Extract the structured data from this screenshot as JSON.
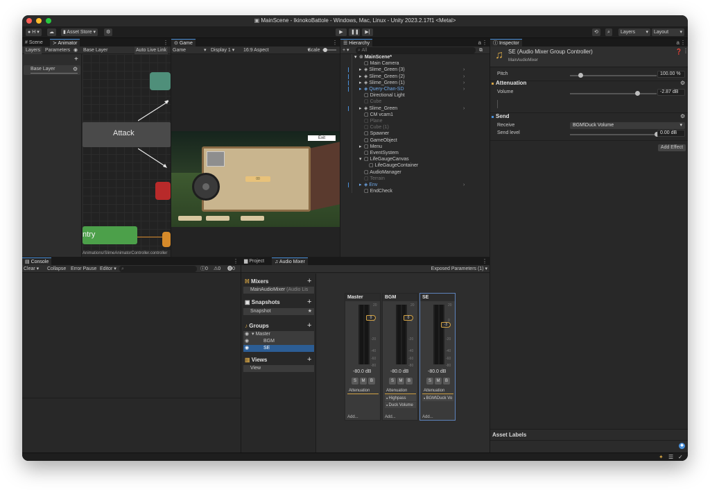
{
  "window": {
    "title": "MainScene - IkinokoBattole - Windows, Mac, Linux - Unity 2023.2.17f1 <Metal>"
  },
  "toolbar": {
    "account_label": "H",
    "asset_store_label": "Asset Store",
    "layers_label": "Layers",
    "layout_label": "Layout"
  },
  "scene_tab": {
    "label": "Scene"
  },
  "animator": {
    "tab_label": "Animator",
    "layers_tab": "Layers",
    "parameters_tab": "Parameters",
    "breadcrumb": "Base Layer",
    "auto_live_link": "Auto Live Link",
    "layer_item": "Base Layer",
    "state_attack": "Attack",
    "state_entry": "ntry",
    "footer_path": "Animations/SlimeAnimatorController.controller"
  },
  "game": {
    "tab_label": "Game",
    "mode": "Game",
    "display": "Display 1",
    "aspect": "16:9 Aspect",
    "scale_label": "Scale",
    "exit_button": "Exit",
    "sign_text": "00"
  },
  "hierarchy": {
    "tab_label": "Hierarchy",
    "search_placeholder": "All",
    "items": [
      {
        "label": "MainScene*",
        "indent": 0,
        "kind": "scene"
      },
      {
        "label": "Main Camera",
        "indent": 1,
        "kind": "object"
      },
      {
        "label": "Slime_Green (3)",
        "indent": 1,
        "kind": "prefab"
      },
      {
        "label": "Slime_Green (2)",
        "indent": 1,
        "kind": "prefab"
      },
      {
        "label": "Slime_Green (1)",
        "indent": 1,
        "kind": "prefab"
      },
      {
        "label": "Query-Chan-SD",
        "indent": 1,
        "kind": "prefab-blue"
      },
      {
        "label": "Directional Light",
        "indent": 1,
        "kind": "object"
      },
      {
        "label": "Cube",
        "indent": 1,
        "kind": "disabled"
      },
      {
        "label": "Slime_Green",
        "indent": 1,
        "kind": "prefab"
      },
      {
        "label": "CM vcam1",
        "indent": 1,
        "kind": "object"
      },
      {
        "label": "Plane",
        "indent": 1,
        "kind": "disabled"
      },
      {
        "label": "Cube (1)",
        "indent": 1,
        "kind": "disabled"
      },
      {
        "label": "Spawner",
        "indent": 1,
        "kind": "object"
      },
      {
        "label": "GameObject",
        "indent": 1,
        "kind": "object"
      },
      {
        "label": "Menu",
        "indent": 1,
        "kind": "object"
      },
      {
        "label": "EventSystem",
        "indent": 1,
        "kind": "object"
      },
      {
        "label": "LifeGaugeCanvas",
        "indent": 1,
        "kind": "object"
      },
      {
        "label": "LifeGaugeContainer",
        "indent": 2,
        "kind": "object"
      },
      {
        "label": "AudioManager",
        "indent": 1,
        "kind": "object"
      },
      {
        "label": "Terrain",
        "indent": 1,
        "kind": "disabled"
      },
      {
        "label": "Env",
        "indent": 1,
        "kind": "prefab-blue"
      },
      {
        "label": "EndCheck",
        "indent": 1,
        "kind": "object"
      }
    ]
  },
  "inspector": {
    "tab_label": "Inspector",
    "component_title": "SE (Audio Mixer Group Controller)",
    "mixer_name": "MainAudioMixer",
    "pitch_label": "Pitch",
    "pitch_value": "100.00 %",
    "pitch_level": 0.12,
    "attenuation_title": "Attenuation",
    "volume_label": "Volume",
    "volume_value": "-2.87 dB",
    "volume_level": 0.78,
    "send_title": "Send",
    "receive_label": "Receive",
    "receive_value": "BGM\\Duck Volume",
    "send_level_label": "Send level",
    "send_level_value": "0.00 dB",
    "send_level_fraction": 1.0,
    "add_effect": "Add Effect",
    "asset_labels": "Asset Labels"
  },
  "console": {
    "tab_label": "Console",
    "clear": "Clear",
    "collapse": "Collapse",
    "error_pause": "Error Pause",
    "editor": "Editor",
    "count_logs": "0",
    "count_warnings": "0",
    "count_errors": "0"
  },
  "project": {
    "tab_label": "Project"
  },
  "audio_mixer": {
    "tab_label": "Audio Mixer",
    "exposed_params": "Exposed Parameters (1)",
    "sections": {
      "mixers": "Mixers",
      "mixer_item": "MainAudioMixer",
      "mixer_item_suffix": "(Audio Lis",
      "snapshots": "Snapshots",
      "snapshot_item": "Snapshot",
      "groups": "Groups",
      "group_master": "Master",
      "group_bgm": "BGM",
      "group_se": "SE",
      "views": "Views",
      "view_item": "View"
    },
    "scale_labels": [
      "20",
      "0",
      "-20",
      "-40",
      "-60",
      "-80"
    ],
    "strips": [
      {
        "name": "Master",
        "fader_value": "0",
        "fader_level": 0.22,
        "db": "-80.0 dB",
        "effects": [
          "Attenuation"
        ],
        "add": "Add..."
      },
      {
        "name": "BGM",
        "fader_value": "0",
        "fader_level": 0.22,
        "db": "-80.0 dB",
        "effects": [
          "Attenuation",
          "Highpass",
          "Duck Volume"
        ],
        "add": "Add..."
      },
      {
        "name": "SE",
        "fader_value": "-3",
        "fader_level": 0.34,
        "db": "-80.0 dB",
        "effects": [
          "Attenuation",
          "BGM\\Duck Vo"
        ],
        "add": "Add..."
      }
    ],
    "smb": [
      "S",
      "M",
      "B"
    ]
  },
  "colors": {
    "accent_blue": "#4a8fd8",
    "prefab_blue": "#6fa8e8",
    "node_green": "#4ca04a",
    "node_teal": "#4f8f7a",
    "node_red": "#b82a2a",
    "node_orange": "#d68a2a",
    "fader_gold": "#d4a445",
    "selection": "#2c5d94"
  }
}
